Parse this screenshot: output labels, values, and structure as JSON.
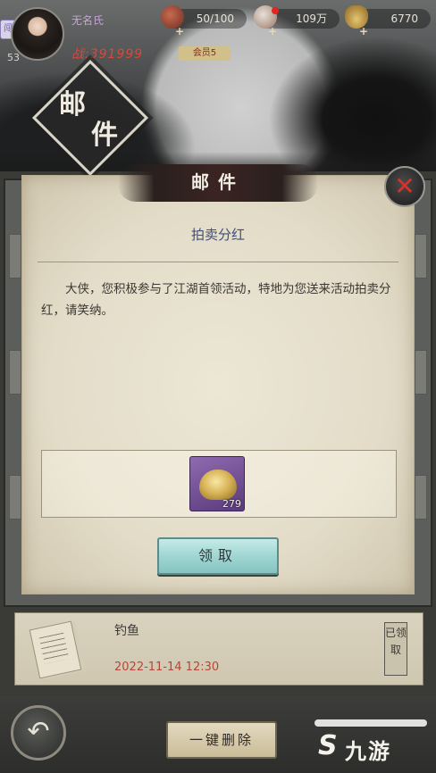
{
  "player": {
    "name": "无名氏",
    "level": "53",
    "power": "战:391999",
    "vip": "会员5",
    "side_badge": "闯"
  },
  "resources": [
    {
      "icon": "stamina-pouch-icon",
      "value": "50/100"
    },
    {
      "icon": "coin-icon",
      "value": "109万"
    },
    {
      "icon": "gold-ingot-icon",
      "value": "6770"
    }
  ],
  "page_title": {
    "char1": "邮",
    "char2": "件"
  },
  "mail_panel": {
    "header": "邮件",
    "subject": "拍卖分红",
    "body": "大侠，您积极参与了江湖首领活动，特地为您送来活动拍卖分红，请笑纳。",
    "attachment": {
      "icon": "gold-ingot-icon",
      "quantity": "279"
    },
    "claim_label": "领取"
  },
  "mail_list": [
    {
      "sender": "钓鱼",
      "date": "2022-11-14 12:30",
      "status": "已领取"
    }
  ],
  "bottom": {
    "delete_all_label": "一键删除",
    "watermark_text": "九游",
    "watermark_mark": "S"
  },
  "colors": {
    "accent_red": "#d64a3a",
    "subject_blue": "#3f4f7a",
    "claim_teal": "#9fd6d3",
    "date_red": "#b2473a"
  }
}
